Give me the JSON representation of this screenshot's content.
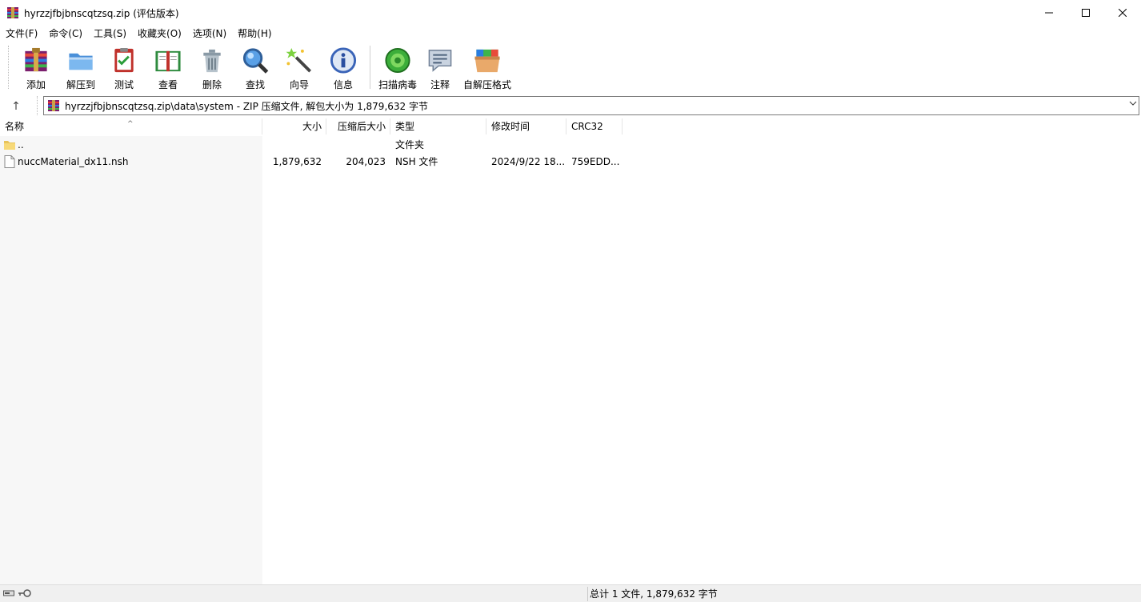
{
  "window": {
    "title": "hyrzzjfbjbnscqtzsq.zip (评估版本)",
    "controls": {
      "minimize": "minimize-icon",
      "maximize": "maximize-icon",
      "close": "close-icon"
    }
  },
  "menu": [
    {
      "label": "文件(F)"
    },
    {
      "label": "命令(C)"
    },
    {
      "label": "工具(S)"
    },
    {
      "label": "收藏夹(O)"
    },
    {
      "label": "选项(N)"
    },
    {
      "label": "帮助(H)"
    }
  ],
  "toolbar": [
    {
      "label": "添加",
      "icon": "add-archive-icon"
    },
    {
      "label": "解压到",
      "icon": "extract-to-icon"
    },
    {
      "label": "测试",
      "icon": "test-icon"
    },
    {
      "label": "查看",
      "icon": "view-book-icon"
    },
    {
      "label": "删除",
      "icon": "delete-trash-icon"
    },
    {
      "label": "查找",
      "icon": "find-magnifier-icon"
    },
    {
      "label": "向导",
      "icon": "wizard-wand-icon"
    },
    {
      "label": "信息",
      "icon": "info-icon"
    },
    {
      "label": "扫描病毒",
      "icon": "virus-scan-icon"
    },
    {
      "label": "注释",
      "icon": "comment-icon"
    },
    {
      "label": "自解压格式",
      "icon": "sfx-box-icon"
    }
  ],
  "address": {
    "path": "hyrzzjfbjbnscqtzsq.zip\\data\\system - ZIP 压缩文件, 解包大小为 1,879,632 字节"
  },
  "columns": {
    "name": "名称",
    "size": "大小",
    "packed": "压缩后大小",
    "type": "类型",
    "modified": "修改时间",
    "crc": "CRC32"
  },
  "files": [
    {
      "name": "..",
      "size": "",
      "packed": "",
      "type": "文件夹",
      "modified": "",
      "crc": "",
      "icon": "folder-icon"
    },
    {
      "name": "nuccMaterial_dx11.nsh",
      "size": "1,879,632",
      "packed": "204,023",
      "type": "NSH 文件",
      "modified": "2024/9/22 18...",
      "crc": "759EDD...",
      "icon": "file-icon"
    }
  ],
  "status": {
    "text": "总计 1 文件, 1,879,632 字节"
  },
  "colors": {
    "name_pane_bg": "#f7f7f7",
    "status_bg": "#f0f0f0"
  }
}
